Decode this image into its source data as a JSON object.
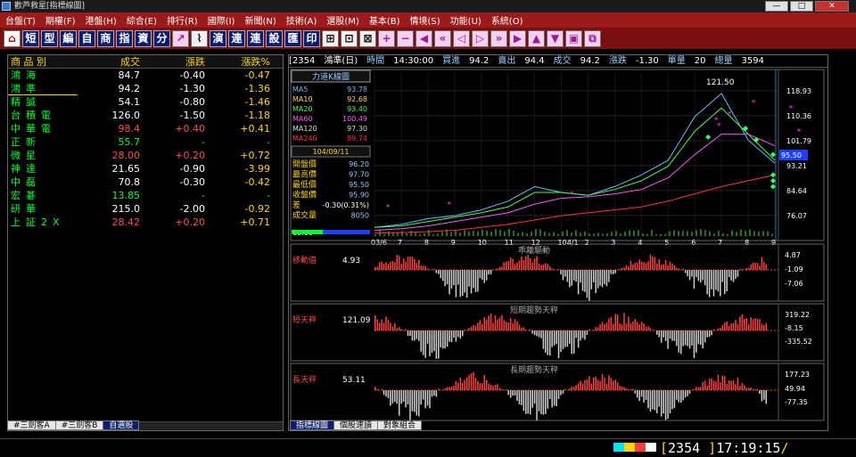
{
  "window": {
    "title": "歡芦救星[指標線圖]",
    "btn_min": "—",
    "btn_max": "□",
    "btn_close": "✕"
  },
  "menu": [
    "台盤(T)",
    "期權(F)",
    "港盤(H)",
    "綜合(E)",
    "排行(R)",
    "國際(I)",
    "新聞(N)",
    "技術(A)",
    "選股(M)",
    "基本(B)",
    "情境(S)",
    "功能(U)",
    "系統(O)"
  ],
  "toolbar": [
    {
      "label": "⌂",
      "icon": "home-icon",
      "style": "home"
    },
    {
      "label": "短",
      "style": "dk"
    },
    {
      "label": "型",
      "style": "dk"
    },
    {
      "label": "編",
      "style": "dk"
    },
    {
      "label": "自",
      "style": "dk"
    },
    {
      "label": "商",
      "style": "dk"
    },
    {
      "label": "指",
      "style": "dk"
    },
    {
      "label": "資",
      "style": "dk"
    },
    {
      "label": "分",
      "style": "dk"
    },
    {
      "label": "↗",
      "icon": "trend-icon",
      "style": "pink"
    },
    {
      "label": "⌇",
      "icon": "chart-icon",
      "style": ""
    },
    {
      "label": "演",
      "style": "dk"
    },
    {
      "label": "連",
      "style": "dk"
    },
    {
      "label": "連",
      "style": "dk"
    },
    {
      "label": "設",
      "style": "dk"
    },
    {
      "label": "匯",
      "style": "dk"
    },
    {
      "label": "印",
      "style": "dk"
    },
    {
      "label": "⊞",
      "icon": "grid-icon",
      "style": ""
    },
    {
      "label": "⊡",
      "icon": "lock-icon",
      "style": ""
    },
    {
      "label": "⊠",
      "icon": "window-icon",
      "style": ""
    },
    {
      "label": "+",
      "icon": "plus-icon",
      "style": "pink"
    },
    {
      "label": "−",
      "icon": "minus-icon",
      "style": "pink"
    },
    {
      "label": "◀",
      "icon": "prev-icon",
      "style": "pink"
    },
    {
      "label": "«",
      "icon": "rewind-icon",
      "style": "pink"
    },
    {
      "label": "◁",
      "icon": "back-icon",
      "style": "pink"
    },
    {
      "label": "▷",
      "icon": "forward-icon",
      "style": "pink"
    },
    {
      "label": "»",
      "icon": "fast-forward-icon",
      "style": "pink"
    },
    {
      "label": "▶",
      "icon": "next-icon",
      "style": "pink"
    },
    {
      "label": "▲",
      "icon": "up-icon",
      "style": "pink"
    },
    {
      "label": "▼",
      "icon": "down-icon",
      "style": "pink"
    },
    {
      "label": "▣",
      "icon": "box-icon",
      "style": "pink"
    },
    {
      "label": "⧉",
      "icon": "copy-icon",
      "style": "pink"
    }
  ],
  "watchlist": {
    "headers": [
      "商 品 別",
      "成交",
      "漲跌",
      "漲跌%"
    ],
    "rows": [
      {
        "name": "鴻海",
        "price": "84.7",
        "chg": "-0.40",
        "pct": "-0.47",
        "dir": "down"
      },
      {
        "name": "鴻準",
        "price": "94.2",
        "chg": "-1.30",
        "pct": "-1.36",
        "dir": "down"
      },
      {
        "name": "精誠",
        "price": "54.1",
        "chg": "-0.80",
        "pct": "-1.46",
        "dir": "down"
      },
      {
        "name": "台積電",
        "price": "126.0",
        "chg": "-1.50",
        "pct": "-1.18",
        "dir": "down"
      },
      {
        "name": "中華電",
        "price": "98.4",
        "chg": "+0.40",
        "pct": "+0.41",
        "dir": "up"
      },
      {
        "name": "正新",
        "price": "55.7",
        "chg": "-",
        "pct": "-",
        "dir": "flat"
      },
      {
        "name": "微星",
        "price": "28.00",
        "chg": "+0.20",
        "pct": "+0.72",
        "dir": "up"
      },
      {
        "name": "神達",
        "price": "21.65",
        "chg": "-0.90",
        "pct": "-3.99",
        "dir": "down"
      },
      {
        "name": "中磊",
        "price": "70.8",
        "chg": "-0.30",
        "pct": "-0.42",
        "dir": "down"
      },
      {
        "name": "宏碁",
        "price": "13.85",
        "chg": "-",
        "pct": "-",
        "dir": "flat"
      },
      {
        "name": "研華",
        "price": "215.0",
        "chg": "-2.00",
        "pct": "-0.92",
        "dir": "down"
      },
      {
        "name": "上証2X",
        "price": "28.42",
        "chg": "+0.20",
        "pct": "+0.71",
        "dir": "up"
      }
    ]
  },
  "left_tabs": [
    "#三劍客A",
    "#三劍客B",
    "自選股"
  ],
  "right_tabs": [
    "指標線圖",
    "個股速讀",
    "對象組合"
  ],
  "quote": {
    "code": "[2354",
    "name": "鴻準(日)",
    "time_label": "時間",
    "time": "14:30:00",
    "bid_label": "買進",
    "bid": "94.2",
    "ask_label": "賣出",
    "ask": "94.4",
    "last_label": "成交",
    "last": "94.2",
    "chg_label": "漲跌",
    "chg": "-1.30",
    "vol_label": "單量",
    "vol": "20",
    "total_label": "總量",
    "total": "3594"
  },
  "ma_legend": {
    "title": "力道K線圖",
    "items": [
      {
        "name": "MA5",
        "value": "93.78",
        "color": "#6fb8ff"
      },
      {
        "name": "MA10",
        "value": "92.68",
        "color": "#ffd84d"
      },
      {
        "name": "MA20",
        "value": "93.40",
        "color": "#44ff44"
      },
      {
        "name": "MA60",
        "value": "100.49",
        "color": "#ff55ff"
      },
      {
        "name": "MA120",
        "value": "97.30",
        "color": "#dddddd"
      },
      {
        "name": "MA240",
        "value": "89.74",
        "color": "#ff3333"
      }
    ]
  },
  "ohlc_box": {
    "date": "104/09/11",
    "rows": [
      {
        "label": "開盤價",
        "value": "96.20"
      },
      {
        "label": "最高價",
        "value": "97.70"
      },
      {
        "label": "最低價",
        "value": "95.50"
      },
      {
        "label": "收盤價",
        "value": "95.90"
      },
      {
        "label": "差",
        "value": "-0.30(0.31%)"
      },
      {
        "label": "成交量",
        "value": "8050"
      }
    ]
  },
  "main_chart": {
    "peak_label": "121.50",
    "current_price": "95.50",
    "price_labels": [
      "118.93",
      "110.36",
      "101.79",
      "93.21",
      "84.64",
      "76.07"
    ],
    "x_labels": [
      "03/6",
      "7",
      "8",
      "9",
      "10",
      "11",
      "12",
      "104/1",
      "2",
      "3",
      "4",
      "5",
      "6",
      "7",
      "8",
      "9"
    ],
    "bottom_left": "69.00"
  },
  "chart_data": [
    {
      "type": "line",
      "title": "力道K線圖",
      "x": [
        "03/6",
        "7",
        "8",
        "9",
        "10",
        "11",
        "12",
        "104/1",
        "2",
        "3",
        "4",
        "5",
        "6",
        "7",
        "8",
        "9"
      ],
      "ylim": [
        69.0,
        125.0
      ],
      "series": [
        {
          "name": "MA5",
          "values": [
            72,
            73,
            75,
            76,
            78,
            81,
            86,
            84,
            83,
            86,
            90,
            95,
            110,
            118,
            102,
            94
          ]
        },
        {
          "name": "MA20",
          "values": [
            72,
            72.5,
            74,
            75.5,
            77,
            79,
            84,
            84,
            83,
            85,
            88,
            93,
            105,
            113,
            104,
            95
          ]
        },
        {
          "name": "MA60",
          "values": [
            71,
            71.5,
            72.5,
            74,
            75.5,
            77,
            80,
            82,
            82.5,
            83.5,
            85,
            89,
            97,
            104,
            104,
            100
          ]
        },
        {
          "name": "MA240",
          "values": [
            70,
            70.2,
            70.5,
            71,
            72,
            73,
            74.5,
            76,
            77,
            78,
            79,
            81,
            83.5,
            86,
            88,
            90
          ]
        }
      ]
    },
    {
      "type": "bar",
      "title": "乖離驅動",
      "series": [
        {
          "name": "移動值",
          "values": []
        }
      ],
      "ylim": [
        -7.06,
        4.87
      ]
    },
    {
      "type": "bar",
      "title": "短期趨勢天秤",
      "series": [
        {
          "name": "短天秤",
          "values": []
        }
      ],
      "ylim": [
        -335.52,
        319.22
      ]
    },
    {
      "type": "bar",
      "title": "長期趨勢天秤",
      "series": [
        {
          "name": "長天秤",
          "values": []
        }
      ],
      "ylim": [
        -77.35,
        177.23
      ]
    }
  ],
  "sub1": {
    "title": "乖離驅動",
    "name": "移動值",
    "value": "4.93",
    "labels": [
      "4.87",
      "-1.09",
      "-7.06"
    ]
  },
  "sub2": {
    "title": "短期趨勢天秤",
    "name": "短天秤",
    "value": "121.09",
    "labels": [
      "319.22",
      "-8.15",
      "-335.52"
    ]
  },
  "sub3": {
    "title": "長期趨勢天秤",
    "name": "長天秤",
    "value": "53.11",
    "labels": [
      "177.23",
      "49.94",
      "-77.35"
    ]
  },
  "status": {
    "code": "2354",
    "time": "17:19:15"
  },
  "colors": {
    "up": "#ff4d4d",
    "down": "#ffffff",
    "flat": "#00ff33",
    "name": "#00ff33",
    "header": "#ffd700"
  }
}
